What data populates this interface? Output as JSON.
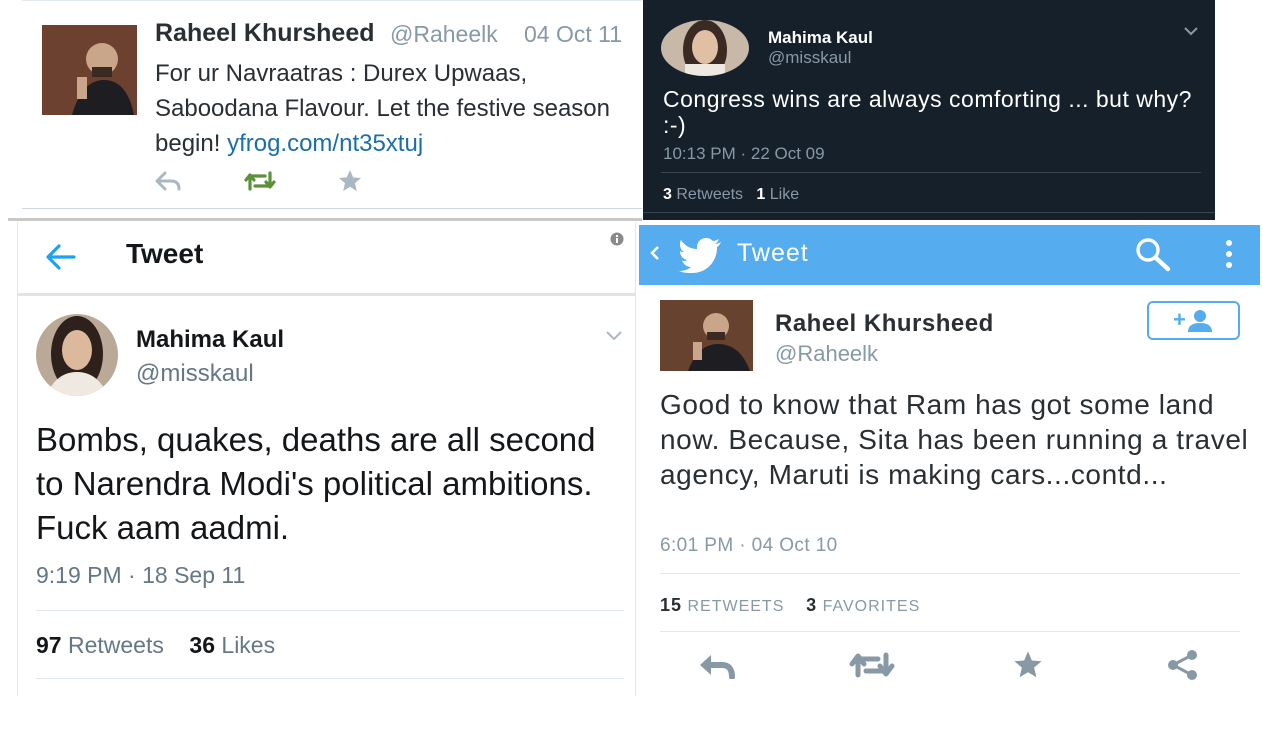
{
  "panel1": {
    "name": "Raheel Khursheed",
    "handle": "@Raheelk",
    "date": "04 Oct 11",
    "text": "For ur Navraatras : Durex Upwaas, Saboodana Flavour. Let the festive season begin! ",
    "link": "yfrog.com/nt35xtuj",
    "icons": [
      "reply-icon",
      "retweet-icon",
      "favorite-icon"
    ],
    "colors": {
      "retweet_active": "#5c913b",
      "muted": "#aab8c2"
    }
  },
  "panel2": {
    "name": "Mahima Kaul",
    "handle": "@misskaul",
    "text": "Congress wins are always comforting ... but why? :-)",
    "time": "10:13 PM · 22 Oct 09",
    "retweets_count": "3",
    "retweets_label": "Retweets",
    "likes_count": "1",
    "likes_label": "Like",
    "colors": {
      "background": "#16202b"
    }
  },
  "panel3": {
    "header_title": "Tweet",
    "name": "Mahima Kaul",
    "handle": "@misskaul",
    "text": "Bombs, quakes, deaths are all second to Narendra Modi's political ambitions. Fuck aam aadmi.",
    "time": "9:19 PM · 18 Sep 11",
    "retweets_count": "97",
    "retweets_label": "Retweets",
    "likes_count": "36",
    "likes_label": "Likes",
    "colors": {
      "accent": "#1da1f2"
    }
  },
  "panel4": {
    "bar_title": "Tweet",
    "name": "Raheel Khursheed",
    "handle": "@Raheelk",
    "follow_label": "+",
    "text": "Good to know that Ram has got some land now. Because, Sita has been running a travel agency, Maruti is making cars...contd...",
    "time": "6:01 PM · 04 Oct 10",
    "retweets_count": "15",
    "retweets_label": "RETWEETS",
    "favorites_count": "3",
    "favorites_label": "FAVORITES",
    "icons": [
      "reply-icon",
      "retweet-icon",
      "favorite-icon",
      "share-icon"
    ],
    "colors": {
      "bar": "#55acee",
      "icon": "#8899a6"
    }
  }
}
